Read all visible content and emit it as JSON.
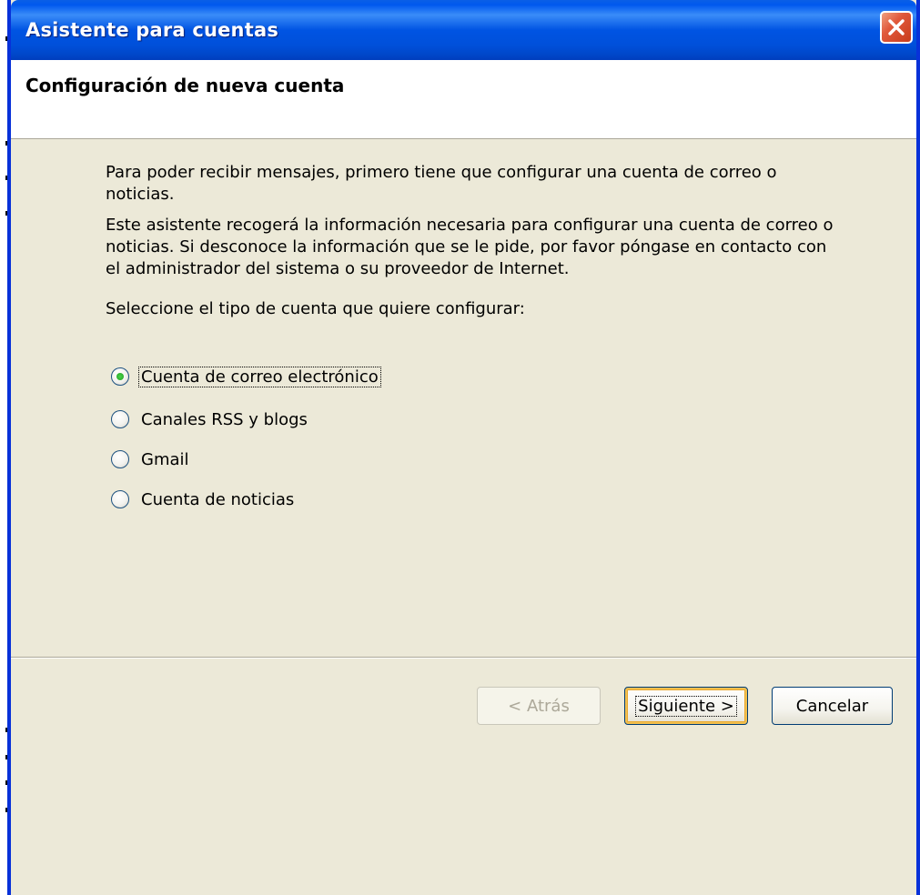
{
  "window": {
    "title": "Asistente para cuentas",
    "close_icon": "close-icon"
  },
  "header": {
    "title": "Configuración de nueva cuenta"
  },
  "intro": {
    "paragraph1": "Para poder recibir mensajes, primero tiene que configurar una cuenta de correo o noticias.",
    "paragraph2": "Este asistente recogerá la información necesaria para configurar una cuenta de correo o noticias. Si desconoce la información que se le pide, por favor póngase en contacto con el administrador del sistema o su proveedor de Internet.",
    "prompt": "Seleccione el tipo de cuenta que quiere configurar:"
  },
  "account_types": {
    "selected": "Cuenta de correo electrónico",
    "options": [
      {
        "label": "Cuenta de correo electrónico",
        "checked": true
      },
      {
        "label": "Canales RSS y blogs",
        "checked": false
      },
      {
        "label": "Gmail",
        "checked": false
      },
      {
        "label": "Cuenta de noticias",
        "checked": false
      }
    ]
  },
  "buttons": {
    "back": {
      "label": "< Atrás",
      "enabled": false
    },
    "next": {
      "label": "Siguiente >",
      "enabled": true
    },
    "cancel": {
      "label": "Cancelar",
      "enabled": true
    }
  },
  "colors": {
    "titlebar": "#0054e3",
    "face": "#ece9d8",
    "close": "#e0583a",
    "radio_dot": "#21a121",
    "default_button_ring": "#f2c050"
  }
}
